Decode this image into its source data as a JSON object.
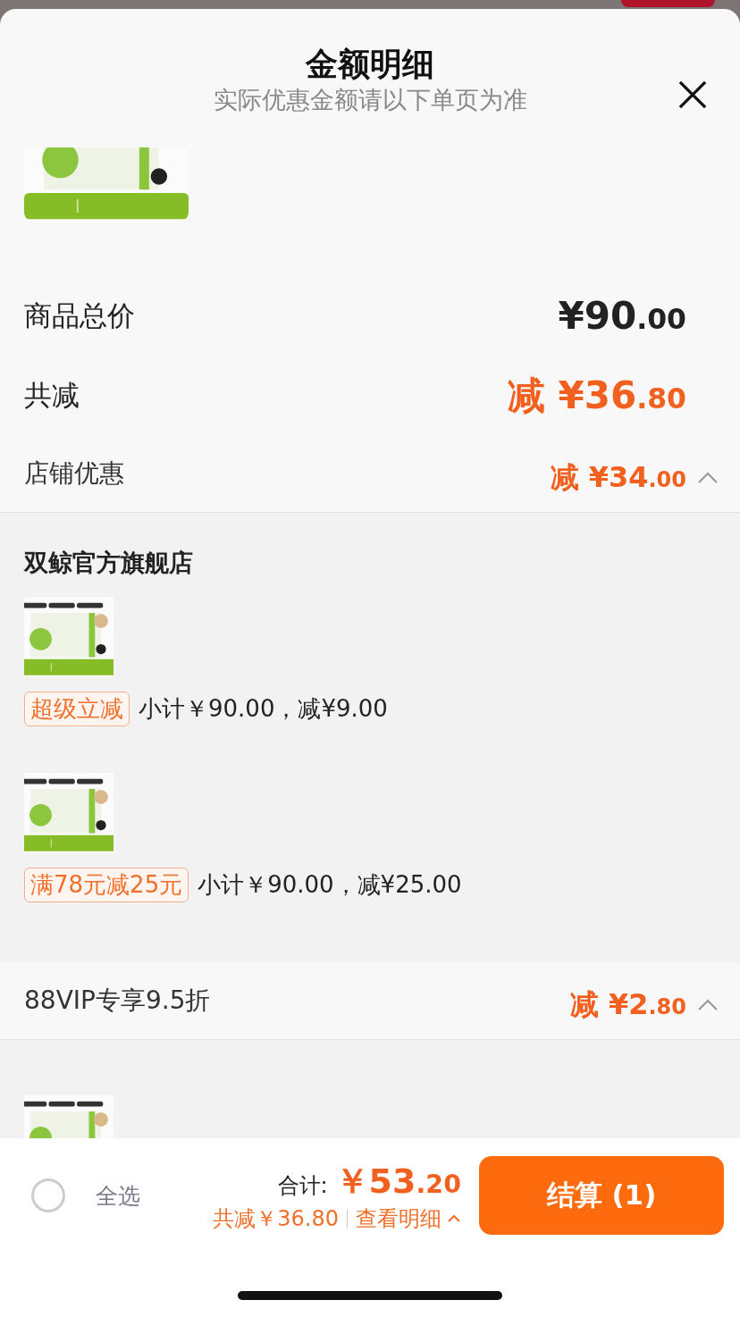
{
  "sheet": {
    "title": "金额明细",
    "subtitle": "实际优惠金额请以下单页为准"
  },
  "summary": [
    {
      "label": "商品总价",
      "amount": "¥90.00",
      "kind": "total"
    },
    {
      "label": "共减",
      "amount": "减 ¥36.80",
      "kind": "discount"
    }
  ],
  "discount_groups": [
    {
      "label": "店铺优惠",
      "amount": "减 ¥34.00",
      "expanded": true,
      "store": "双鲸官方旗舰店",
      "items": [
        {
          "kind": "picture"
        },
        {
          "tag": "超级立减",
          "detail": "小计￥90.00，减¥9.00"
        },
        {
          "kind": "picture"
        },
        {
          "tag": "满78元减25元",
          "detail": "小计￥90.00，减¥25.00"
        }
      ]
    },
    {
      "label": "88VIP专享9.5折",
      "amount": "减 ¥2.80",
      "expanded": true,
      "items": [
        {
          "kind": "picture"
        }
      ]
    }
  ],
  "footer": {
    "select_all": {
      "label": "全选",
      "checked": false
    },
    "total_label": "合计:",
    "total": "￥53.20",
    "saved": "共减￥36.80",
    "details_link": "查看明细",
    "checkout": "结算 (1)"
  }
}
